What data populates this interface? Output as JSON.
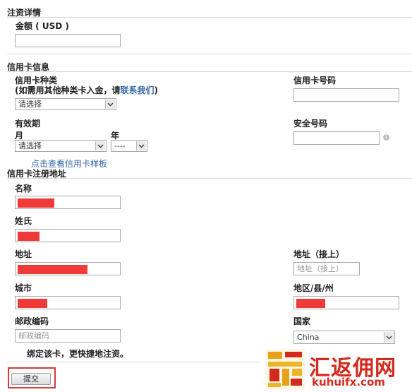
{
  "deposit": {
    "section_title": "注资详情",
    "amount_label": "金额 ( USD )",
    "amount_value": ""
  },
  "card": {
    "section_title": "信用卡信息",
    "type_label": "信用卡种类",
    "type_hint_prefix": "(如需用其他种类卡入金，请",
    "type_hint_link": "联系我们",
    "type_hint_suffix": ")",
    "type_select": "请选择",
    "number_label": "信用卡号码",
    "number_value": "",
    "expiry_label": "有效期",
    "month_label": "月",
    "month_select": "请选择",
    "year_label": "年",
    "year_select": "----",
    "security_label": "安全号码",
    "security_value": "",
    "sample_link": "点击查看信用卡样板"
  },
  "address": {
    "section_title": "信用卡注册地址",
    "first_name_label": "名称",
    "last_name_label": "姓氏",
    "address_label": "地址",
    "address2_label": "地址（接上）",
    "address2_placeholder": "地址（接上）",
    "city_label": "城市",
    "region_label": "地区/县/州",
    "postcode_label": "邮政编码",
    "postcode_placeholder": "邮政编码",
    "country_label": "国家",
    "country_select": "China"
  },
  "bind_card_label": "绑定该卡，更快捷地注资。",
  "submit_label": "提交",
  "watermark": {
    "text": "汇返佣网",
    "url": "kuhuifx.com"
  },
  "colors": {
    "redaction": "#f03a3a",
    "highlight_border": "#d63a3a",
    "link": "#3366aa",
    "watermark": "#d42a1d"
  }
}
